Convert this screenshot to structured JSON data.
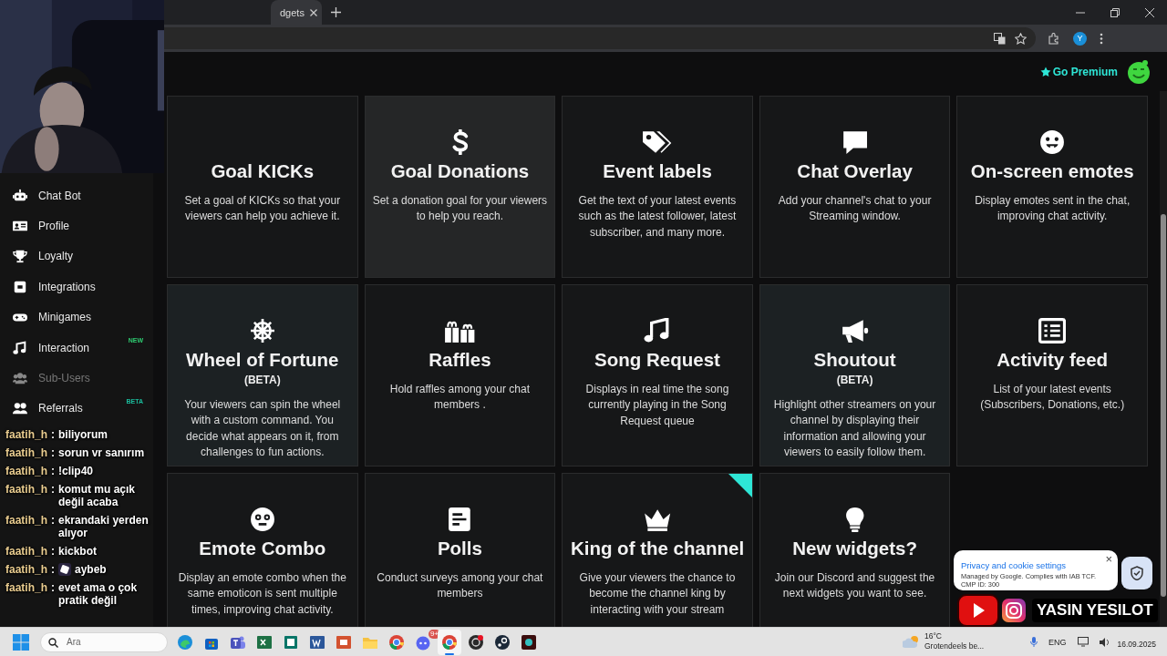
{
  "browser": {
    "tab": {
      "title": "dgets",
      "selected": true
    },
    "profile_initial": "Y"
  },
  "header": {
    "premium_label": "Go Premium"
  },
  "sidebar": {
    "items": [
      {
        "label": "Chat Bot",
        "disabled": false
      },
      {
        "label": "Profile",
        "disabled": false
      },
      {
        "label": "Loyalty",
        "disabled": false
      },
      {
        "label": "Integrations",
        "disabled": false
      },
      {
        "label": "Minigames",
        "disabled": false
      },
      {
        "label": "Interaction",
        "disabled": false,
        "badge": {
          "text": "NEW",
          "color": "#2ecc71"
        }
      },
      {
        "label": "Sub-Users",
        "disabled": true
      },
      {
        "label": "Referrals",
        "disabled": false,
        "badge": {
          "text": "BETA",
          "color": "#1abc9c"
        }
      }
    ]
  },
  "widgets": [
    {
      "title": "Goal KICKs",
      "description": "Set a goal of KICKs so that your viewers can help you achieve it.",
      "highlighted": false,
      "corner_flag": false
    },
    {
      "title": "Goal Donations",
      "description": "Set a donation goal for your viewers to help you reach.",
      "highlighted": true,
      "corner_flag": false
    },
    {
      "title": "Event labels",
      "description": "Get the text of your latest events such as the latest follower, latest subscriber, and many more.",
      "highlighted": false,
      "corner_flag": false
    },
    {
      "title": "Chat Overlay",
      "description": "Add your channel's chat to your Streaming window.",
      "highlighted": false,
      "corner_flag": false
    },
    {
      "title": "On-screen emotes",
      "description": "Display emotes sent in the chat, improving chat activity.",
      "highlighted": false,
      "corner_flag": false
    },
    {
      "title": "Wheel of Fortune",
      "subtitle": "(BETA)",
      "description": "Your viewers can spin the wheel with a custom command. You decide what appears on it, from challenges to fun actions.",
      "highlighted": true,
      "corner_flag": false
    },
    {
      "title": "Raffles",
      "description": "Hold raffles among your chat members .",
      "highlighted": false,
      "corner_flag": false
    },
    {
      "title": "Song Request",
      "description": "Displays in real time the song currently playing in the Song Request queue",
      "highlighted": false,
      "corner_flag": false
    },
    {
      "title": "Shoutout",
      "subtitle": "(BETA)",
      "description": "Highlight other streamers on your channel by displaying their information and allowing your viewers to easily follow them.",
      "highlighted": true,
      "corner_flag": false
    },
    {
      "title": "Activity feed",
      "description": "List of your latest events (Subscribers, Donations, etc.)",
      "highlighted": false,
      "corner_flag": false
    },
    {
      "title": "Emote Combo",
      "description": "Display an emote combo when the same emoticon is sent multiple times, improving chat activity.",
      "highlighted": false,
      "corner_flag": false
    },
    {
      "title": "Polls",
      "description": "Conduct surveys among your chat members",
      "highlighted": false,
      "corner_flag": false
    },
    {
      "title": "King of the channel",
      "description": "Give your viewers the chance to become the channel king by interacting with your stream",
      "highlighted": false,
      "corner_flag": true
    },
    {
      "title": "New widgets?",
      "description": "Join our Discord and suggest the next widgets you want to see.",
      "highlighted": false,
      "corner_flag": false
    }
  ],
  "chat": [
    {
      "user": "faatih_h",
      "separator": ":",
      "text": "biliyorum",
      "kind": "text"
    },
    {
      "user": "faatih_h",
      "separator": ":",
      "text": "sorun vr sanırım",
      "kind": "text"
    },
    {
      "user": "faatih_h",
      "separator": ":",
      "text": "!clip40",
      "kind": "text"
    },
    {
      "user": "faatih_h",
      "separator": ":",
      "text": "komut mu açık değil acaba",
      "kind": "text"
    },
    {
      "user": "faatih_h",
      "separator": ":",
      "text": "ekrandaki yerden alıyor",
      "kind": "text"
    },
    {
      "user": "faatih_h",
      "separator": ":",
      "text": "kickbot",
      "kind": "text"
    },
    {
      "user": "faatih_h",
      "separator": ":",
      "text": "aybeb",
      "kind": "emote"
    },
    {
      "user": "faatih_h",
      "separator": ":",
      "text": "evet ama o çok pratik değil",
      "kind": "text"
    }
  ],
  "cookie_popup": {
    "title": "Privacy and cookie settings",
    "lines": [
      "Managed by Google. Complies with IAB TCF.",
      "CMP ID: 300"
    ],
    "close": "×"
  },
  "stream_overlay": {
    "name": "YASIN YESILOT"
  },
  "taskbar": {
    "search": {
      "placeholder": "Ara"
    },
    "apps": [
      {
        "selected": false
      },
      {
        "selected": false
      },
      {
        "selected": false
      },
      {
        "selected": false
      },
      {
        "selected": false
      },
      {
        "selected": false
      },
      {
        "selected": false
      },
      {
        "selected": false
      },
      {
        "selected": false
      },
      {
        "selected": false,
        "badge": "9+"
      },
      {
        "selected": true
      },
      {
        "selected": false
      },
      {
        "selected": false
      },
      {
        "selected": false
      }
    ],
    "weather": {
      "temperature": "16°C",
      "condition": "Grotendeels be..."
    },
    "language": "ENG",
    "date": "16.09.2025"
  }
}
